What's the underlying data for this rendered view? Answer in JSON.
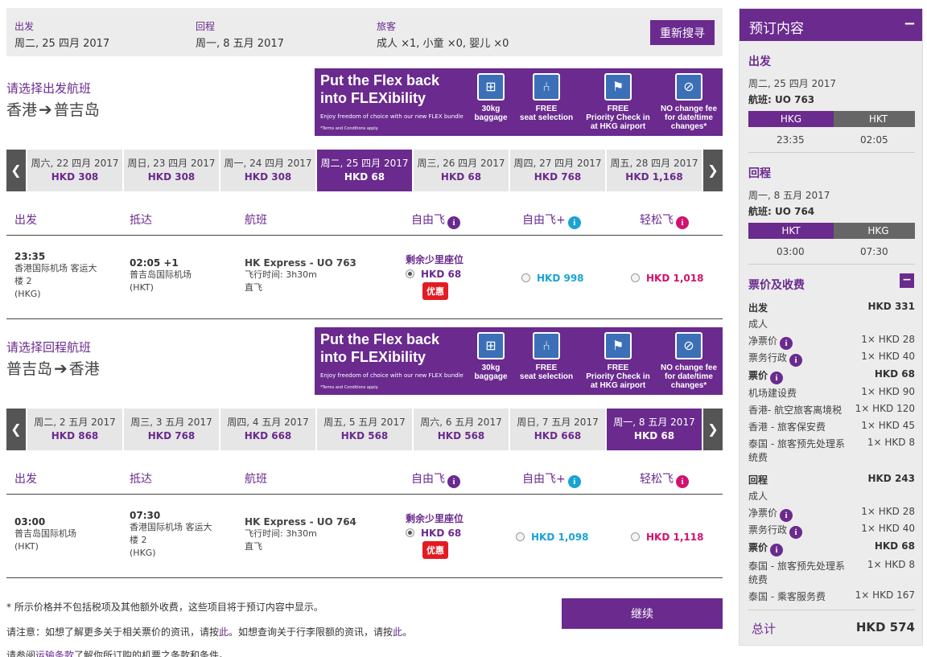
{
  "summary": {
    "depart_label": "出发",
    "depart_value": "周二, 25 四月 2017",
    "return_label": "回程",
    "return_value": "周一, 8 五月 2017",
    "pax_label": "旅客",
    "pax_value": "成人 ×1, 小童 ×0, 婴儿 ×0",
    "research_btn": "重新搜寻"
  },
  "banner": {
    "headline_1": "Put the Flex back",
    "headline_2": "into FLEXibility",
    "sub": "Enjoy freedom of choice with our new FLEX bundle",
    "terms": "*Terms and Conditions apply.",
    "features": [
      {
        "line1": "30kg",
        "line2": "baggage",
        "line3": ""
      },
      {
        "line1": "FREE",
        "line2": "seat selection",
        "line3": ""
      },
      {
        "line1": "FREE",
        "line2": "Priority Check in",
        "line3": "at HKG airport"
      },
      {
        "line1": "NO change fee",
        "line2": "for date/time",
        "line3": "changes*"
      }
    ]
  },
  "outbound": {
    "title": "请选择出发航班",
    "from": "香港",
    "to": "普吉岛",
    "dates": [
      {
        "date": "周六, 22 四月 2017",
        "price": "HKD 308"
      },
      {
        "date": "周日, 23 四月 2017",
        "price": "HKD 308"
      },
      {
        "date": "周一, 24 四月 2017",
        "price": "HKD 308"
      },
      {
        "date": "周二, 25 四月 2017",
        "price": "HKD 68"
      },
      {
        "date": "周三, 26 四月 2017",
        "price": "HKD 68"
      },
      {
        "date": "周四, 27 四月 2017",
        "price": "HKD 768"
      },
      {
        "date": "周五, 28 四月 2017",
        "price": "HKD 1,168"
      }
    ],
    "flight": {
      "dep_time": "23:35",
      "dep_airport_1": "香港国际机场 客运大",
      "dep_airport_2": "楼 2",
      "dep_code": "(HKG)",
      "arr_time": "02:05 +1",
      "arr_airport": "普吉岛国际机场",
      "arr_code": "(HKT)",
      "flight_name": "HK Express - UO 763",
      "duration": "飞行时间: 3h30m",
      "type": "直飞",
      "few_seats": "剩余少里座位",
      "fare1": "HKD 68",
      "promo": "优惠",
      "fare2": "HKD 998",
      "fare3": "HKD 1,018"
    }
  },
  "inbound": {
    "title": "请选择回程航班",
    "from": "普吉岛",
    "to": "香港",
    "dates": [
      {
        "date": "周二, 2 五月 2017",
        "price": "HKD 868"
      },
      {
        "date": "周三, 3 五月 2017",
        "price": "HKD 768"
      },
      {
        "date": "周四, 4 五月 2017",
        "price": "HKD 668"
      },
      {
        "date": "周五, 5 五月 2017",
        "price": "HKD 568"
      },
      {
        "date": "周六, 6 五月 2017",
        "price": "HKD 568"
      },
      {
        "date": "周日, 7 五月 2017",
        "price": "HKD 668"
      },
      {
        "date": "周一, 8 五月 2017",
        "price": "HKD 68"
      }
    ],
    "flight": {
      "dep_time": "03:00",
      "dep_airport": "普吉岛国际机场",
      "dep_code": "(HKT)",
      "arr_time": "07:30",
      "arr_airport_1": "香港国际机场 客运大",
      "arr_airport_2": "楼 2",
      "arr_code": "(HKG)",
      "flight_name": "HK Express - UO 764",
      "duration": "飞行时间: 3h30m",
      "type": "直飞",
      "few_seats": "剩余少里座位",
      "fare1": "HKD 68",
      "promo": "优惠",
      "fare2": "HKD 1,098",
      "fare3": "HKD 1,118"
    }
  },
  "columns": {
    "depart": "出发",
    "arrive": "抵达",
    "flight": "航班",
    "fly": "自由飞",
    "fly_plus": "自由飞+",
    "easy": "轻松飞"
  },
  "footer": {
    "note": "* 所示价格并不包括税项及其他额外收费，这些项目将于预订内容中显示。",
    "info_a": "请注意：如想了解更多关于相关票价的资讯，请按",
    "info_link1": "此",
    "info_b": "。如想查询关于行李限额的资讯，请按",
    "info_link2": "此",
    "info_c": "。",
    "terms_a": "请参阅",
    "terms_link": "运输条款",
    "terms_b": "了解你所订购的机票之条款和条件。",
    "continue_btn": "继续"
  },
  "sidebar": {
    "title": "预订内容",
    "out_title": "出发",
    "out_date": "周二, 25 四月 2017",
    "out_flight": "航班: UO 763",
    "out_from": "HKG",
    "out_to": "HKT",
    "out_dep": "23:35",
    "out_arr": "02:05",
    "ret_title": "回程",
    "ret_date": "周一, 8 五月 2017",
    "ret_flight": "航班: UO 764",
    "ret_from": "HKT",
    "ret_to": "HKG",
    "ret_dep": "03:00",
    "ret_arr": "07:30",
    "fee_title": "票价及收费",
    "out_sum_label": "出发",
    "out_sum": "HKD 331",
    "adult": "成人",
    "out_rows": [
      {
        "label": "净票价",
        "value": "1× HKD 28",
        "info": true
      },
      {
        "label": "票务行政",
        "value": "1× HKD 40",
        "info": true
      }
    ],
    "out_fare_label": "票价",
    "out_fare": "HKD 68",
    "out_tax_rows": [
      {
        "label": "机场建设费",
        "value": "1× HKD 90"
      },
      {
        "label": "香港- 航空旅客离境税",
        "value": "1× HKD 120"
      },
      {
        "label": "香港 - 旅客保安费",
        "value": "1× HKD 45"
      },
      {
        "label": "泰国 - 旅客预先处理系",
        "label2": "统费",
        "value": "1× HKD 8"
      }
    ],
    "ret_sum_label": "回程",
    "ret_sum": "HKD 243",
    "ret_rows": [
      {
        "label": "净票价",
        "value": "1× HKD 28",
        "info": true
      },
      {
        "label": "票务行政",
        "value": "1× HKD 40",
        "info": true
      }
    ],
    "ret_fare_label": "票价",
    "ret_fare": "HKD 68",
    "ret_tax_rows": [
      {
        "label": "泰国 - 旅客预先处理系",
        "label2": "统费",
        "value": "1× HKD 8"
      },
      {
        "label": "泰国 - 乘客服务费",
        "value": "1× HKD 167"
      }
    ],
    "total_label": "总计",
    "total": "HKD 574"
  },
  "colors": {
    "brand": "#6a2a8e",
    "fly_plus": "#1aa3d3",
    "easy": "#d1126f",
    "promo": "#e31b23"
  }
}
